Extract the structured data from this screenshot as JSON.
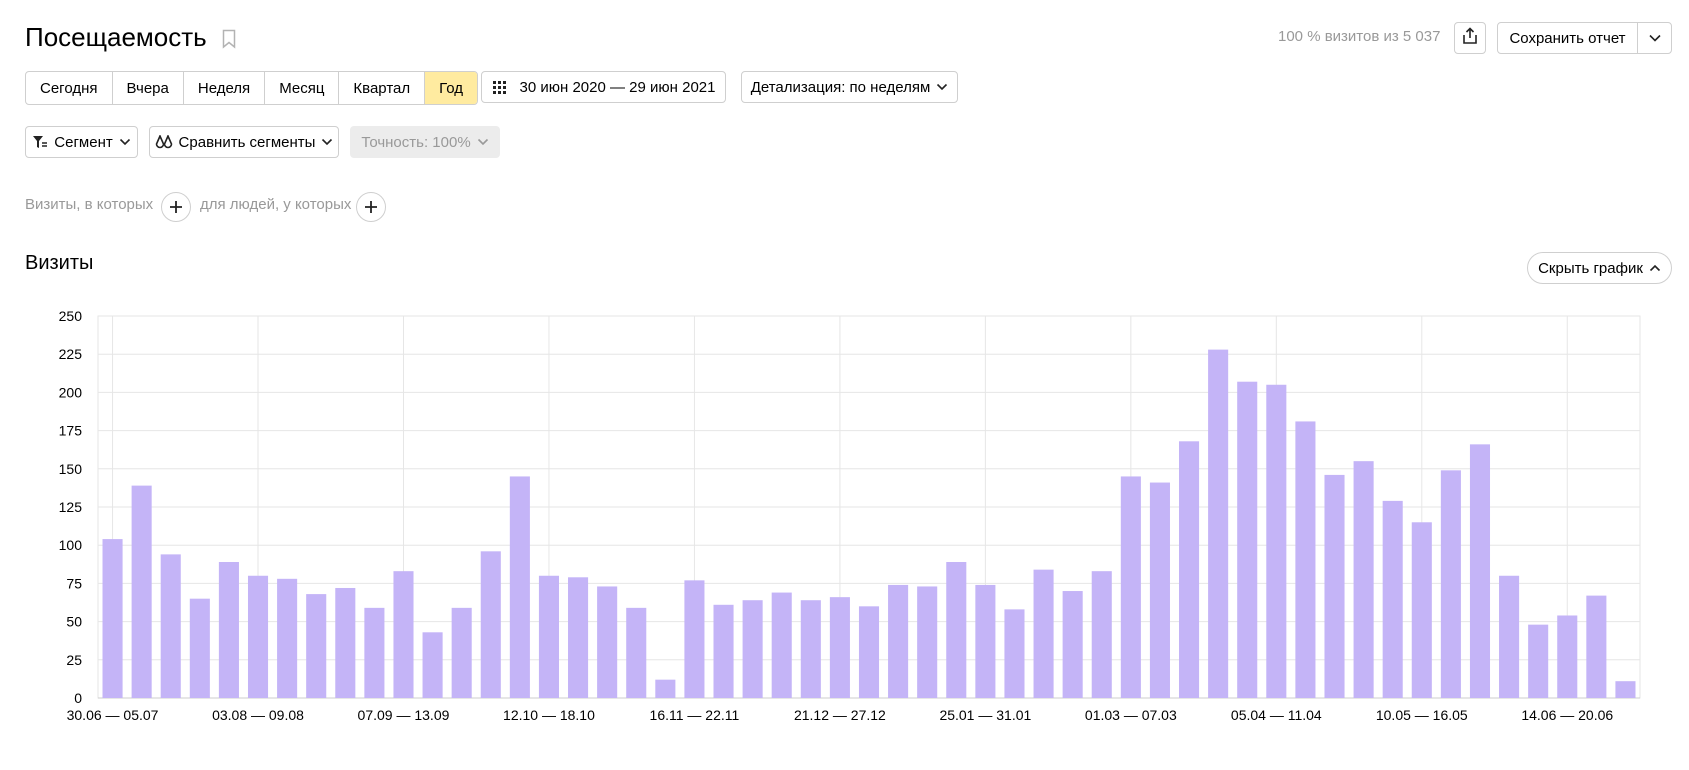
{
  "header": {
    "title": "Посещаемость",
    "summary": "100 % визитов из 5 037",
    "save_label": "Сохранить отчет"
  },
  "periods": [
    "Сегодня",
    "Вчера",
    "Неделя",
    "Месяц",
    "Квартал",
    "Год"
  ],
  "active_period": "Год",
  "date_range": "30 июн 2020 — 29 июн 2021",
  "detail_label": "Детализация: по неделям",
  "segment_label": "Сегмент",
  "compare_label": "Сравнить сегменты",
  "accuracy_label": "Точность: 100%",
  "filters": {
    "visits_label": "Визиты, в которых",
    "people_label": "для людей, у которых"
  },
  "section_title": "Визиты",
  "hide_chart_label": "Скрыть график",
  "colors": {
    "bar": "#c4b4f7",
    "active_period": "#ffeba0",
    "grid": "#e6e6e6"
  },
  "icons": [
    "bookmark-icon",
    "share-icon",
    "chevron-down-icon",
    "calendar-icon",
    "filter-icon",
    "compare-icon",
    "plus-icon",
    "chevron-up-icon"
  ],
  "chart_data": {
    "type": "bar",
    "ylim": [
      0,
      250
    ],
    "yticks": [
      0,
      25,
      50,
      75,
      100,
      125,
      150,
      175,
      200,
      225,
      250
    ],
    "x_tick_labels": [
      "30.06 — 05.07",
      "03.08 — 09.08",
      "07.09 — 13.09",
      "12.10 — 18.10",
      "16.11 — 22.11",
      "21.12 — 27.12",
      "25.01 — 31.01",
      "01.03 — 07.03",
      "05.04 — 11.04",
      "10.05 — 16.05",
      "14.06 — 20.06"
    ],
    "label_every": 5,
    "values": [
      104,
      139,
      94,
      65,
      89,
      80,
      78,
      68,
      72,
      59,
      83,
      43,
      59,
      96,
      145,
      80,
      79,
      73,
      59,
      12,
      77,
      61,
      64,
      69,
      64,
      66,
      60,
      74,
      73,
      89,
      74,
      58,
      84,
      70,
      83,
      145,
      141,
      168,
      228,
      207,
      205,
      181,
      146,
      155,
      129,
      115,
      149,
      166,
      80,
      48,
      54,
      67,
      11
    ],
    "grid": true
  }
}
